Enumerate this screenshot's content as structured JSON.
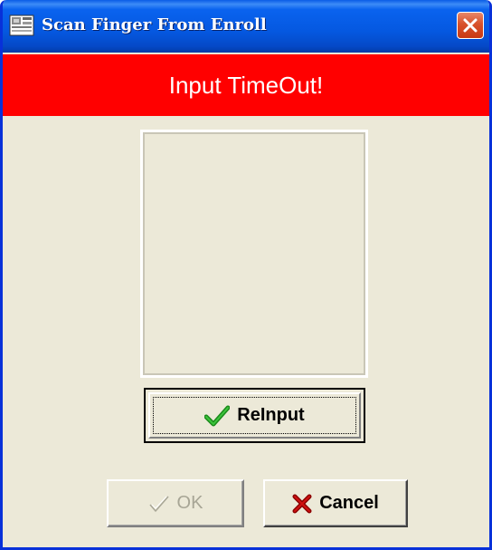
{
  "window": {
    "title": "Scan Finger From Enroll",
    "icons": {
      "app": "window-app-icon",
      "close": "close-x-icon"
    }
  },
  "banner": {
    "message": "Input TimeOut!",
    "color": "#ff0000",
    "text_color": "#ffffff"
  },
  "fingerprint_preview": {
    "state": "empty"
  },
  "buttons": {
    "reinput": {
      "label": "ReInput",
      "icon": "green-checkmark-icon",
      "state": "focused"
    },
    "ok": {
      "label": "OK",
      "icon": "checkmark-outline-icon",
      "state": "disabled"
    },
    "cancel": {
      "label": "Cancel",
      "icon": "red-x-icon",
      "state": "enabled"
    }
  },
  "colors": {
    "titlebar": "#0558e0",
    "dialog_background": "#ece9d8",
    "reinput_check": "#1a8a1a",
    "cancel_x": "#8b0000",
    "disabled_text": "#a7a595"
  }
}
